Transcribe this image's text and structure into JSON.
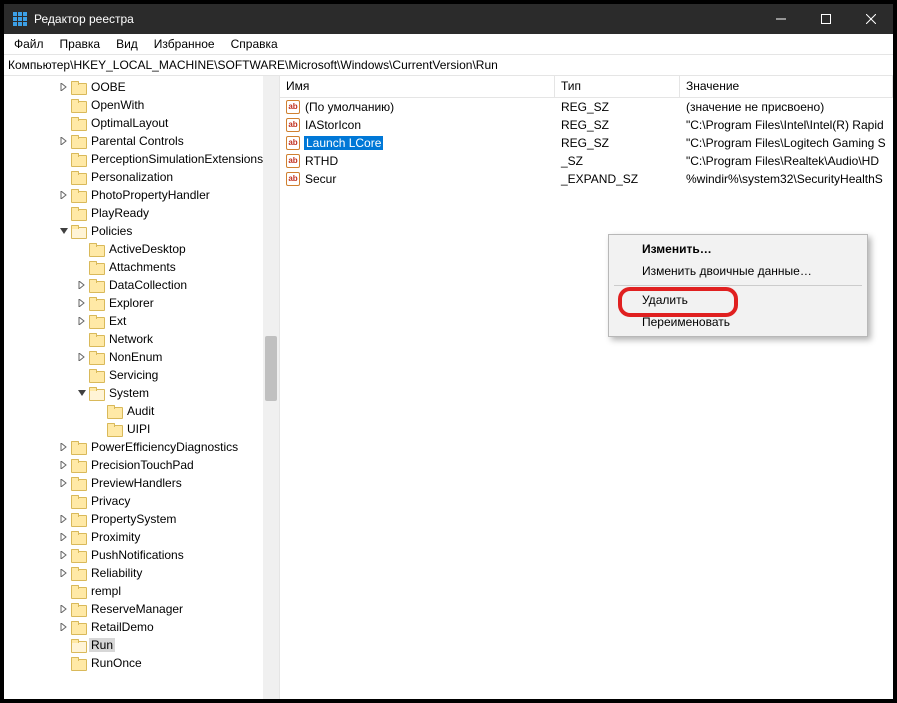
{
  "title": "Редактор реестра",
  "menu": [
    "Файл",
    "Правка",
    "Вид",
    "Избранное",
    "Справка"
  ],
  "address": "Компьютер\\HKEY_LOCAL_MACHINE\\SOFTWARE\\Microsoft\\Windows\\CurrentVersion\\Run",
  "tree": [
    {
      "d": 3,
      "e": "r",
      "l": "OOBE"
    },
    {
      "d": 3,
      "e": "",
      "l": "OpenWith"
    },
    {
      "d": 3,
      "e": "",
      "l": "OptimalLayout"
    },
    {
      "d": 3,
      "e": "r",
      "l": "Parental Controls"
    },
    {
      "d": 3,
      "e": "",
      "l": "PerceptionSimulationExtensions"
    },
    {
      "d": 3,
      "e": "",
      "l": "Personalization"
    },
    {
      "d": 3,
      "e": "r",
      "l": "PhotoPropertyHandler"
    },
    {
      "d": 3,
      "e": "",
      "l": "PlayReady"
    },
    {
      "d": 3,
      "e": "d",
      "l": "Policies",
      "open": true
    },
    {
      "d": 4,
      "e": "",
      "l": "ActiveDesktop"
    },
    {
      "d": 4,
      "e": "",
      "l": "Attachments"
    },
    {
      "d": 4,
      "e": "r",
      "l": "DataCollection"
    },
    {
      "d": 4,
      "e": "r",
      "l": "Explorer"
    },
    {
      "d": 4,
      "e": "r",
      "l": "Ext"
    },
    {
      "d": 4,
      "e": "",
      "l": "Network"
    },
    {
      "d": 4,
      "e": "r",
      "l": "NonEnum"
    },
    {
      "d": 4,
      "e": "",
      "l": "Servicing"
    },
    {
      "d": 4,
      "e": "d",
      "l": "System",
      "open": true
    },
    {
      "d": 5,
      "e": "",
      "l": "Audit"
    },
    {
      "d": 5,
      "e": "",
      "l": "UIPI"
    },
    {
      "d": 3,
      "e": "r",
      "l": "PowerEfficiencyDiagnostics"
    },
    {
      "d": 3,
      "e": "r",
      "l": "PrecisionTouchPad"
    },
    {
      "d": 3,
      "e": "r",
      "l": "PreviewHandlers"
    },
    {
      "d": 3,
      "e": "",
      "l": "Privacy"
    },
    {
      "d": 3,
      "e": "r",
      "l": "PropertySystem"
    },
    {
      "d": 3,
      "e": "r",
      "l": "Proximity"
    },
    {
      "d": 3,
      "e": "r",
      "l": "PushNotifications"
    },
    {
      "d": 3,
      "e": "r",
      "l": "Reliability"
    },
    {
      "d": 3,
      "e": "",
      "l": "rempl"
    },
    {
      "d": 3,
      "e": "r",
      "l": "ReserveManager"
    },
    {
      "d": 3,
      "e": "r",
      "l": "RetailDemo"
    },
    {
      "d": 3,
      "e": "",
      "l": "Run",
      "sel": true
    },
    {
      "d": 3,
      "e": "",
      "l": "RunOnce"
    }
  ],
  "cols": {
    "name": "Имя",
    "type": "Тип",
    "val": "Значение"
  },
  "rows": [
    {
      "name": "(По умолчанию)",
      "type": "REG_SZ",
      "val": "(значение не присвоено)"
    },
    {
      "name": "IAStorIcon",
      "type": "REG_SZ",
      "val": "\"C:\\Program Files\\Intel\\Intel(R) Rapid"
    },
    {
      "name": "Launch LCore",
      "type": "REG_SZ",
      "val": "\"C:\\Program Files\\Logitech Gaming S",
      "sel": true
    },
    {
      "name": "RTHD",
      "type": "_SZ",
      "val": "\"C:\\Program Files\\Realtek\\Audio\\HD"
    },
    {
      "name": "Secur",
      "type": "_EXPAND_SZ",
      "val": "%windir%\\system32\\SecurityHealthS"
    }
  ],
  "ctx": {
    "edit": "Изменить…",
    "editbin": "Изменить двоичные данные…",
    "delete": "Удалить",
    "rename": "Переименовать"
  }
}
